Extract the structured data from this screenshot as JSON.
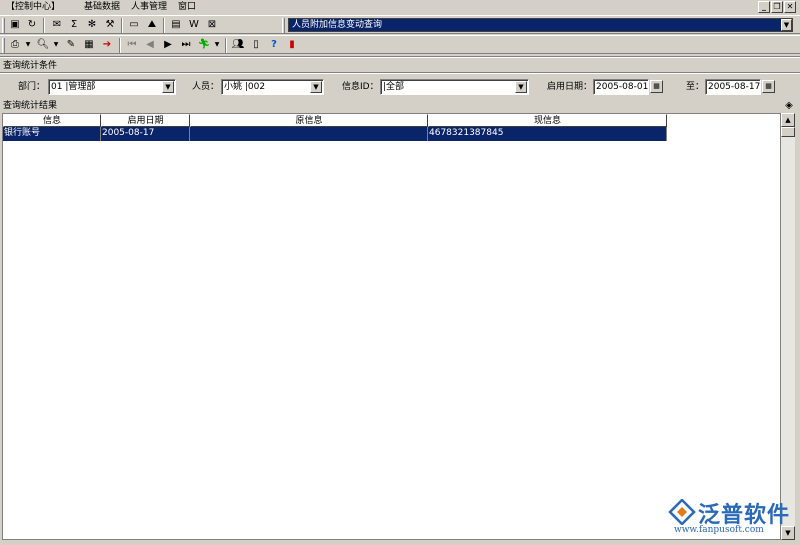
{
  "menu": {
    "items": [
      "【控制中心】",
      "基础数据",
      "人事管理",
      "窗口"
    ]
  },
  "window_controls": {
    "minimize": "_",
    "restore": "❐",
    "close": "✕"
  },
  "toolbar": {
    "title_combo_value": "人员附加信息变动查询"
  },
  "query": {
    "section_label": "查询统计条件",
    "dept_label": "部门：",
    "dept_value": "01 |管理部",
    "person_label": "人员：",
    "person_value": "小姚 |002",
    "infoid_label": "信息ID：",
    "infoid_value": "|全部",
    "start_date_label": "启用日期：",
    "start_date_value": "2005-08-01",
    "to_label": "至：",
    "end_date_value": "2005-08-17"
  },
  "results": {
    "section_label": "查询统计结果",
    "columns": [
      "信息",
      "启用日期",
      "原信息",
      "现信息"
    ],
    "rows": [
      [
        "银行账号",
        "2005-08-17",
        "",
        "4678321387845"
      ]
    ]
  },
  "logo": {
    "name": "泛普软件",
    "url": "www.fanpusoft.com"
  },
  "colors": {
    "selection": "#0a246a",
    "chrome": "#d4d0c8",
    "brand": "#2a68b8"
  }
}
